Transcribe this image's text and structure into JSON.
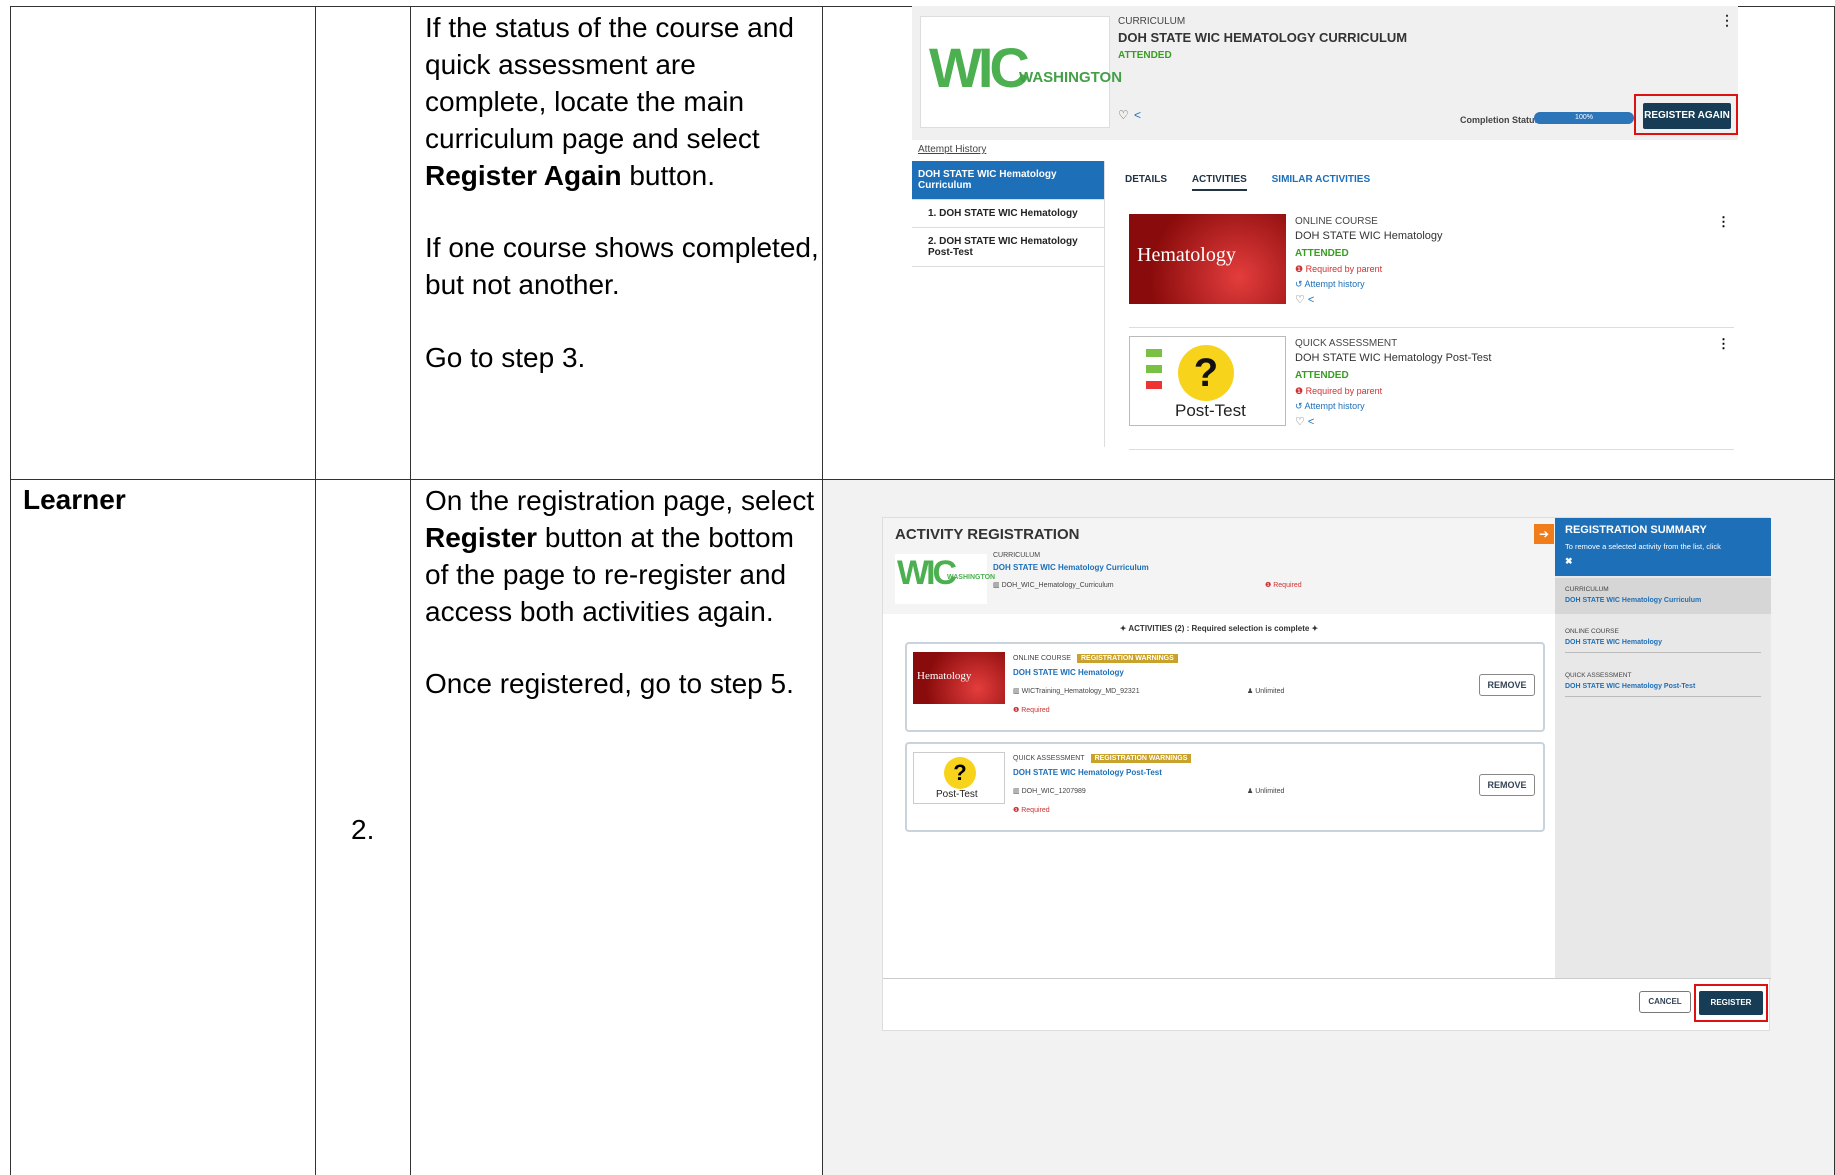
{
  "row1": {
    "instructions": {
      "p1_before": "If the status of the course and quick assessment are complete, locate the main curriculum page and select ",
      "p1_bold": "Register Again",
      "p1_after": " button.",
      "p2": "If one course shows completed, but not another.",
      "p3": "Go to step 3."
    },
    "screenshot": {
      "logo_letters": "WIC",
      "logo_state": "WASHINGTON",
      "type": "CURRICULUM",
      "title": "DOH STATE WIC HEMATOLOGY CURRICULUM",
      "status": "ATTENDED",
      "completion_label": "Completion Status",
      "completion_value": "100%",
      "completion_fraction": 1.0,
      "register_again": "REGISTER AGAIN",
      "attempt_history": "Attempt History",
      "nav": [
        "DOH STATE WIC Hematology Curriculum",
        "1. DOH STATE WIC Hematology",
        "2. DOH STATE WIC Hematology Post-Test"
      ],
      "tabs": [
        "DETAILS",
        "ACTIVITIES",
        "SIMILAR ACTIVITIES"
      ],
      "activities": [
        {
          "type": "ONLINE COURSE",
          "title": "DOH STATE WIC Hematology",
          "status": "ATTENDED",
          "required": "Required by parent",
          "history": "Attempt history",
          "thumb": "Hematology"
        },
        {
          "type": "QUICK ASSESSMENT",
          "title": "DOH STATE WIC Hematology Post-Test",
          "status": "ATTENDED",
          "required": "Required by parent",
          "history": "Attempt history",
          "thumb": "Post-Test"
        }
      ]
    }
  },
  "row2": {
    "role": "Learner",
    "step": "2.",
    "instructions": {
      "p1_before": "On the registration page, select ",
      "p1_bold": "Register",
      "p1_after": " button at the bottom of the page to re-register and access both activities again.",
      "p2": "Once registered, go to step 5."
    },
    "screenshot": {
      "title": "ACTIVITY REGISTRATION",
      "cur_type": "CURRICULUM",
      "cur_title": "DOH STATE WIC Hematology Curriculum",
      "cur_code": "DOH_WIC_Hematology_Curriculum",
      "cur_required": "Required",
      "activities_bar": "ACTIVITIES (2) : Required selection is complete",
      "cards": [
        {
          "type": "ONLINE COURSE",
          "badge": "REGISTRATION WARNINGS",
          "title": "DOH STATE WIC Hematology",
          "code": "WICTraining_Hematology_MD_92321",
          "seats": "Unlimited",
          "required": "Required",
          "remove": "REMOVE",
          "thumb": "Hematology"
        },
        {
          "type": "QUICK ASSESSMENT",
          "badge": "REGISTRATION WARNINGS",
          "title": "DOH STATE WIC Hematology Post-Test",
          "code": "DOH_WIC_1207989",
          "seats": "Unlimited",
          "required": "Required",
          "remove": "REMOVE",
          "thumb": "Post-Test"
        }
      ],
      "summary": {
        "title": "REGISTRATION SUMMARY",
        "hint": "To remove a selected activity from the list, click",
        "items": [
          {
            "type": "CURRICULUM",
            "title": "DOH STATE WIC Hematology Curriculum"
          },
          {
            "type": "ONLINE COURSE",
            "title": "DOH STATE WIC Hematology"
          },
          {
            "type": "QUICK ASSESSMENT",
            "title": "DOH STATE WIC Hematology Post-Test"
          }
        ]
      },
      "cancel": "CANCEL",
      "register": "REGISTER"
    }
  }
}
